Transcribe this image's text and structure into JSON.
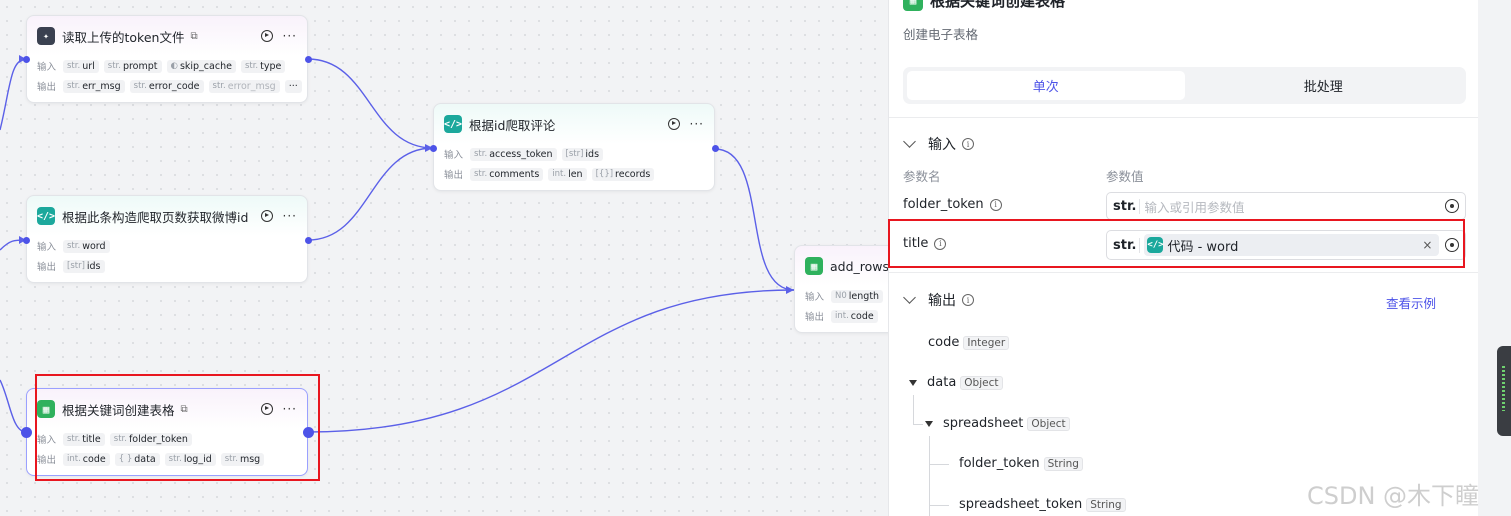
{
  "canvas": {
    "nodes": {
      "read_token": {
        "title": "读取上传的token文件",
        "input_label": "输入",
        "output_label": "输出",
        "inputs": [
          {
            "type": "str.",
            "name": "url"
          },
          {
            "type": "str.",
            "name": "prompt"
          },
          {
            "type": "",
            "name": "skip_cache"
          },
          {
            "type": "str.",
            "name": "type"
          }
        ],
        "outputs": [
          {
            "type": "str.",
            "name": "err_msg"
          },
          {
            "type": "str.",
            "name": "error_code"
          },
          {
            "type": "str.",
            "name": "error_msg"
          }
        ],
        "overflow": "···"
      },
      "build_pages": {
        "title": "根据此条构造爬取页数获取微博id",
        "input_label": "输入",
        "output_label": "输出",
        "inputs": [
          {
            "type": "str.",
            "name": "word"
          }
        ],
        "outputs": [
          {
            "type": "[str]",
            "name": "ids"
          }
        ]
      },
      "crawl_comments": {
        "title": "根据id爬取评论",
        "input_label": "输入",
        "output_label": "输出",
        "inputs": [
          {
            "type": "str.",
            "name": "access_token"
          },
          {
            "type": "[str]",
            "name": "ids"
          }
        ],
        "outputs": [
          {
            "type": "str.",
            "name": "comments"
          },
          {
            "type": "int.",
            "name": "len"
          },
          {
            "type": "[{}]",
            "name": "records"
          }
        ]
      },
      "add_rows": {
        "title": "add_rows",
        "input_label": "输入",
        "output_label": "输出",
        "inputs": [
          {
            "type": "N0",
            "name": "length"
          }
        ],
        "outputs": [
          {
            "type": "int.",
            "name": "code"
          }
        ]
      },
      "create_sheet": {
        "title": "根据关键词创建表格",
        "input_label": "输入",
        "output_label": "输出",
        "inputs": [
          {
            "type": "str.",
            "name": "title"
          },
          {
            "type": "str.",
            "name": "folder_token"
          }
        ],
        "outputs": [
          {
            "type": "int.",
            "name": "code"
          },
          {
            "type": "{ }",
            "name": "data"
          },
          {
            "type": "str.",
            "name": "log_id"
          },
          {
            "type": "str.",
            "name": "msg"
          }
        ]
      }
    }
  },
  "panel": {
    "title": "根据关键词创建表格",
    "subtitle": "创建电子表格",
    "tabs": [
      {
        "label": "单次",
        "active": true
      },
      {
        "label": "批处理",
        "active": false
      }
    ],
    "input_section": {
      "title": "输入",
      "col_name": "参数名",
      "col_value": "参数值",
      "params": [
        {
          "name": "folder_token",
          "type": "str.",
          "placeholder": "输入或引用参数值"
        },
        {
          "name": "title",
          "type": "str.",
          "ref_text": "代码 - word",
          "ref_close": "×"
        }
      ]
    },
    "output_section": {
      "title": "输出",
      "view_example": "查看示例",
      "fields": [
        {
          "name": "code",
          "type": "Integer"
        },
        {
          "name": "data",
          "type": "Object"
        },
        {
          "name": "spreadsheet",
          "type": "Object"
        },
        {
          "name": "folder_token",
          "type": "String"
        },
        {
          "name": "spreadsheet_token",
          "type": "String"
        }
      ]
    }
  },
  "colors": {
    "accent": "#4d53e8",
    "highlight": "#e8161f",
    "code_icon": "#1ba89c",
    "sheet_icon": "#2fb15d"
  },
  "watermark": "CSDN @木下瞳"
}
